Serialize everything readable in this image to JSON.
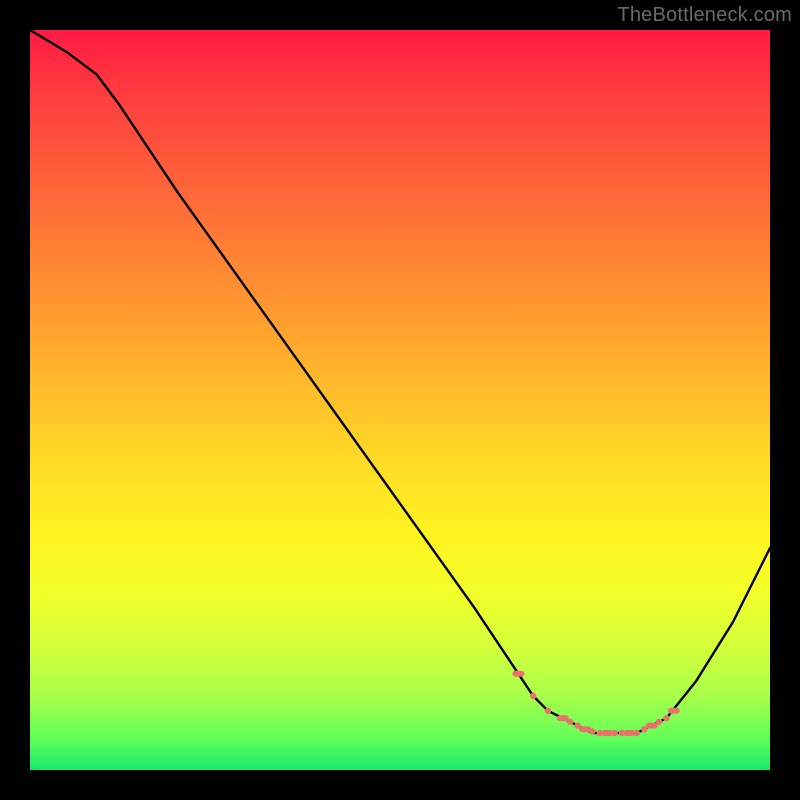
{
  "watermark": "TheBottleneck.com",
  "chart_data": {
    "type": "line",
    "title": "",
    "xlabel": "",
    "ylabel": "",
    "xlim": [
      0,
      100
    ],
    "ylim": [
      0,
      100
    ],
    "grid": false,
    "legend": false,
    "series": [
      {
        "name": "bottleneck-curve",
        "x": [
          0,
          5,
          9,
          12,
          20,
          30,
          40,
          50,
          60,
          66,
          68,
          70,
          72,
          74,
          76,
          78,
          80,
          82,
          84,
          86,
          90,
          95,
          100
        ],
        "y": [
          100,
          97,
          94,
          90,
          78,
          64,
          50,
          36,
          22,
          13,
          10,
          8,
          7,
          6,
          5,
          5,
          5,
          5,
          6,
          7,
          12,
          20,
          30
        ]
      }
    ],
    "markers": {
      "name": "optimal-range-dots",
      "color": "#e9736b",
      "x": [
        66,
        68,
        70,
        72,
        73,
        74,
        75,
        76,
        77,
        78,
        79,
        80,
        81,
        82,
        83,
        84,
        85,
        86,
        87
      ],
      "y": [
        13,
        10,
        8,
        7,
        6.5,
        6,
        5.5,
        5.2,
        5,
        5,
        5,
        5,
        5,
        5,
        5.5,
        6,
        6.5,
        7,
        8
      ]
    },
    "background_gradient": {
      "top": "#ff1a44",
      "mid_high": "#ff9a30",
      "mid": "#fff321",
      "mid_low": "#d6ff3a",
      "bottom": "#18e86a"
    }
  }
}
